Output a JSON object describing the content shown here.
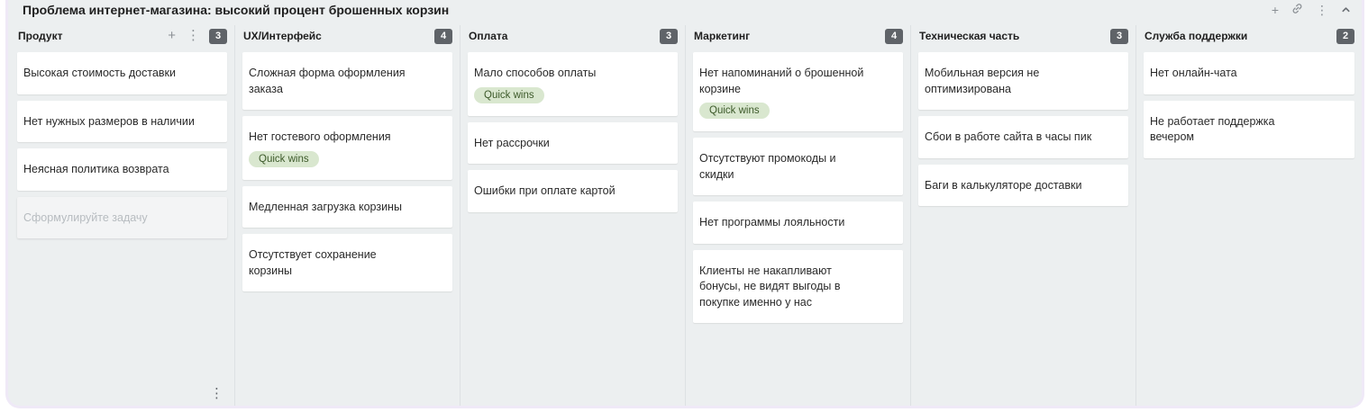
{
  "board": {
    "title": "Проблема интернет-магазина: высокий процент брошенных корзин",
    "actions": {
      "add": "+",
      "link": "🔗",
      "more": "⋮",
      "collapse": "^"
    }
  },
  "columns": [
    {
      "title": "Продукт",
      "count": "3",
      "tools": {
        "add": "+",
        "more": "⋮"
      },
      "cards": [
        {
          "text": "Высокая стоимость доставки"
        },
        {
          "text": "Нет нужных размеров в наличии"
        },
        {
          "text": "Неясная политика возврата"
        }
      ],
      "placeholder": "Сформулируйте задачу",
      "footer_more": "⋮"
    },
    {
      "title": "UX/Интерфейс",
      "count": "4",
      "cards": [
        {
          "text": "Сложная форма оформления заказа"
        },
        {
          "text": "Нет гостевого оформления",
          "tag": "Quick wins"
        },
        {
          "text": "Медленная загрузка корзины"
        },
        {
          "text": "Отсутствует сохранение корзины"
        }
      ]
    },
    {
      "title": "Оплата",
      "count": "3",
      "cards": [
        {
          "text": "Мало способов оплаты",
          "tag": "Quick wins"
        },
        {
          "text": "Нет рассрочки"
        },
        {
          "text": "Ошибки при оплате картой"
        }
      ]
    },
    {
      "title": "Маркетинг",
      "count": "4",
      "cards": [
        {
          "text": "Нет напоминаний о брошенной корзине",
          "tag": "Quick wins"
        },
        {
          "text": "Отсутствуют промокоды и скидки"
        },
        {
          "text": "Нет программы лояльности"
        },
        {
          "text": "Клиенты не накапливают бонусы, не видят выгоды в покупке именно у нас"
        }
      ]
    },
    {
      "title": "Техническая часть",
      "count": "3",
      "cards": [
        {
          "text": "Мобильная версия не оптимизирована"
        },
        {
          "text": "Сбои в работе сайта в часы пик"
        },
        {
          "text": "Баги в калькуляторе доставки"
        }
      ]
    },
    {
      "title": "Служба поддержки",
      "count": "2",
      "cards": [
        {
          "text": "Нет онлайн-чата"
        },
        {
          "text": "Не работает поддержка вечером"
        }
      ]
    }
  ],
  "colors": {
    "board_bg": "#eceff0",
    "card_bg": "#ffffff",
    "badge_bg": "#5f6368",
    "tag_bg": "#d9e7cf",
    "tag_text": "#3d5a2a",
    "frame_border": "#efe9f7"
  }
}
